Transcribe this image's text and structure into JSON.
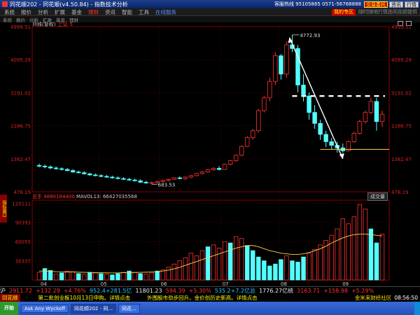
{
  "titlebar": {
    "title": "同花顺202 - 同花顺(v4.50.84) - 指数技术分析",
    "hotline": "客服热线 95105885 0571-56768888",
    "buttons": [
      "交易委托",
      "资讯",
      "行情"
    ]
  },
  "menubar": {
    "items": [
      "系统",
      "报价",
      "分析",
      "扩展",
      "基金",
      "理财",
      "资讯",
      "智能",
      "工具",
      "在线服务"
    ],
    "active_index": 5,
    "my_zone": "我的专区",
    "notice": "随时随地行情由同花顺提供"
  },
  "toolbar": {
    "items": [
      "系统",
      "报价",
      "分析",
      "扩展",
      "基金",
      "理财"
    ]
  },
  "chart": {
    "period_label": "月线(复权)",
    "symbol": "上证",
    "symbol_suffix": "5",
    "high_label": "4772.93",
    "low_label": "683.53",
    "y_ticks": [
      "4999.51",
      "4095.29",
      "3191.02",
      "2286.75",
      "1382.47",
      "478.19"
    ],
    "x_ticks": [
      "04",
      "05",
      "06",
      "07",
      "08",
      "09"
    ]
  },
  "chart_data": [
    {
      "type": "candlestick",
      "ylim": [
        478.19,
        4999.51
      ],
      "ohlc": [
        [
          1200,
          1250,
          1150,
          1180
        ],
        [
          1180,
          1220,
          1120,
          1160
        ],
        [
          1160,
          1200,
          1100,
          1130
        ],
        [
          1130,
          1170,
          1080,
          1110
        ],
        [
          1110,
          1150,
          1060,
          1090
        ],
        [
          1090,
          1130,
          1040,
          1060
        ],
        [
          1060,
          1100,
          1000,
          1020
        ],
        [
          1020,
          1060,
          980,
          1000
        ],
        [
          1000,
          1040,
          950,
          970
        ],
        [
          970,
          1000,
          920,
          940
        ],
        [
          940,
          980,
          900,
          920
        ],
        [
          920,
          960,
          880,
          900
        ],
        [
          900,
          940,
          860,
          880
        ],
        [
          880,
          920,
          840,
          860
        ],
        [
          860,
          900,
          820,
          840
        ],
        [
          840,
          880,
          800,
          820
        ],
        [
          820,
          860,
          780,
          800
        ],
        [
          800,
          840,
          760,
          780
        ],
        [
          780,
          820,
          720,
          740
        ],
        [
          740,
          780,
          700,
          720
        ],
        [
          720,
          760,
          683.53,
          730
        ],
        [
          730,
          780,
          700,
          760
        ],
        [
          760,
          810,
          730,
          790
        ],
        [
          790,
          840,
          760,
          820
        ],
        [
          820,
          880,
          800,
          860
        ],
        [
          860,
          900,
          820,
          840
        ],
        [
          840,
          900,
          800,
          880
        ],
        [
          880,
          940,
          850,
          920
        ],
        [
          920,
          1000,
          900,
          980
        ],
        [
          980,
          1050,
          950,
          1020
        ],
        [
          1020,
          1100,
          990,
          1080
        ],
        [
          1080,
          1150,
          1050,
          1120
        ],
        [
          1120,
          1180,
          1060,
          1090
        ],
        [
          1090,
          1250,
          1080,
          1230
        ],
        [
          1230,
          1350,
          1200,
          1330
        ],
        [
          1330,
          1500,
          1300,
          1480
        ],
        [
          1480,
          1750,
          1450,
          1720
        ],
        [
          1720,
          2000,
          1700,
          1960
        ],
        [
          1960,
          2200,
          1900,
          2150
        ],
        [
          2150,
          2750,
          2100,
          2700
        ],
        [
          2700,
          3100,
          2650,
          3050
        ],
        [
          3050,
          3600,
          2950,
          3500
        ],
        [
          3500,
          4300,
          3400,
          4200
        ],
        [
          4200,
          4250,
          3550,
          3700
        ],
        [
          3700,
          4600,
          3600,
          4500
        ],
        [
          4500,
          4772.93,
          4300,
          4400
        ],
        [
          4400,
          4500,
          3200,
          3400
        ],
        [
          3400,
          3700,
          2950,
          3100
        ],
        [
          3100,
          3200,
          2450,
          2650
        ],
        [
          2650,
          2850,
          2200,
          2350
        ],
        [
          2350,
          2450,
          1900,
          2050
        ],
        [
          2050,
          2150,
          1700,
          1850
        ],
        [
          1850,
          1950,
          1650,
          1750
        ],
        [
          1750,
          1850,
          1550,
          1680
        ],
        [
          1680,
          1800,
          1550,
          1600
        ],
        [
          1600,
          1880,
          1580,
          1850
        ],
        [
          1850,
          2120,
          1820,
          2080
        ],
        [
          2080,
          2450,
          2050,
          2400
        ],
        [
          2400,
          2700,
          2350,
          2650
        ],
        [
          2650,
          3050,
          2600,
          2950
        ],
        [
          2950,
          3050,
          2150,
          2400
        ],
        [
          2400,
          2700,
          2250,
          2600
        ]
      ]
    },
    {
      "type": "bar",
      "title": "MAVOL13",
      "ylim": [
        0,
        125000
      ],
      "y_ticks": [
        "120111",
        "90393",
        "60055",
        "30337"
      ],
      "values": [
        12000,
        18000,
        15000,
        9000,
        11000,
        14000,
        13000,
        10000,
        9000,
        12000,
        11000,
        10000,
        9000,
        8000,
        10000,
        12000,
        14000,
        12000,
        10000,
        9000,
        11000,
        14000,
        16000,
        20000,
        25000,
        30000,
        35000,
        42000,
        38000,
        46000,
        52000,
        55000,
        50000,
        60000,
        58000,
        68000,
        65000,
        54000,
        46000,
        36000,
        30000,
        22000,
        25000,
        32000,
        38000,
        30000,
        28000,
        36000,
        42000,
        48000,
        55000,
        62000,
        70000,
        80000,
        96000,
        88000,
        99000,
        118000,
        111000,
        80000,
        58000,
        72000
      ],
      "colors": [
        "r",
        "c",
        "c",
        "r",
        "c",
        "r",
        "r",
        "c",
        "r",
        "c",
        "r",
        "c",
        "r",
        "c",
        "c",
        "r",
        "c",
        "r",
        "c",
        "r",
        "r",
        "c",
        "r",
        "r",
        "r",
        "r",
        "r",
        "r",
        "r",
        "r",
        "c",
        "r",
        "r",
        "r",
        "c",
        "r",
        "r",
        "c",
        "c",
        "c",
        "c",
        "c",
        "c",
        "c",
        "r",
        "c",
        "c",
        "c",
        "r",
        "r",
        "r",
        "r",
        "r",
        "r",
        "r",
        "r",
        "r",
        "r",
        "r",
        "c",
        "c",
        "r"
      ],
      "ma": [
        14000,
        14000,
        13500,
        13000,
        12800,
        12600,
        12500,
        12200,
        12000,
        11800,
        11600,
        11400,
        11200,
        11000,
        11200,
        11400,
        11600,
        11800,
        12000,
        12200,
        12500,
        13000,
        14000,
        15500,
        17500,
        20000,
        23000,
        26000,
        29000,
        32000,
        35000,
        38000,
        41000,
        44000,
        47000,
        50000,
        52000,
        54000,
        54000,
        52000,
        49000,
        46000,
        44000,
        42000,
        41000,
        40000,
        40000,
        41000,
        43000,
        46000,
        49000,
        53000,
        58000,
        62000,
        66000,
        69000,
        71000,
        72000,
        72000,
        71000,
        70000,
        69000
      ]
    }
  ],
  "volume": {
    "label": "总手",
    "value": "4880184400",
    "ma_label": "MAVOL13: 66427035568",
    "button": "成交量",
    "side_tab": "指标窗口"
  },
  "status": {
    "market": "沪",
    "index": "2911.72",
    "change": "+132.29",
    "change_pct": "+4.76%",
    "deep": "深",
    "deep_val": "11801.23",
    "small": "594.39",
    "small_pct": "+5.30%",
    "vol1": "952.4+281.5亿",
    "vol2": "535.2+7.2亿总",
    "vol3": "1776.27亿统",
    "right_val": "3163.71",
    "right_change": "+158.98",
    "right_pct": "+5.29%"
  },
  "news": {
    "logo": "同花顺",
    "items": [
      "第二批创业板10月13日申购。详情点击",
      "外围股市劲步回升。金价创历史新高。详情点击"
    ],
    "brand": "金米来财经社区",
    "time": "08:56:50"
  },
  "taskbar": {
    "start": "开始",
    "tasks": [
      "Ask Any Wyckoff",
      "同花顺202 - 同...",
      "同花..."
    ]
  }
}
